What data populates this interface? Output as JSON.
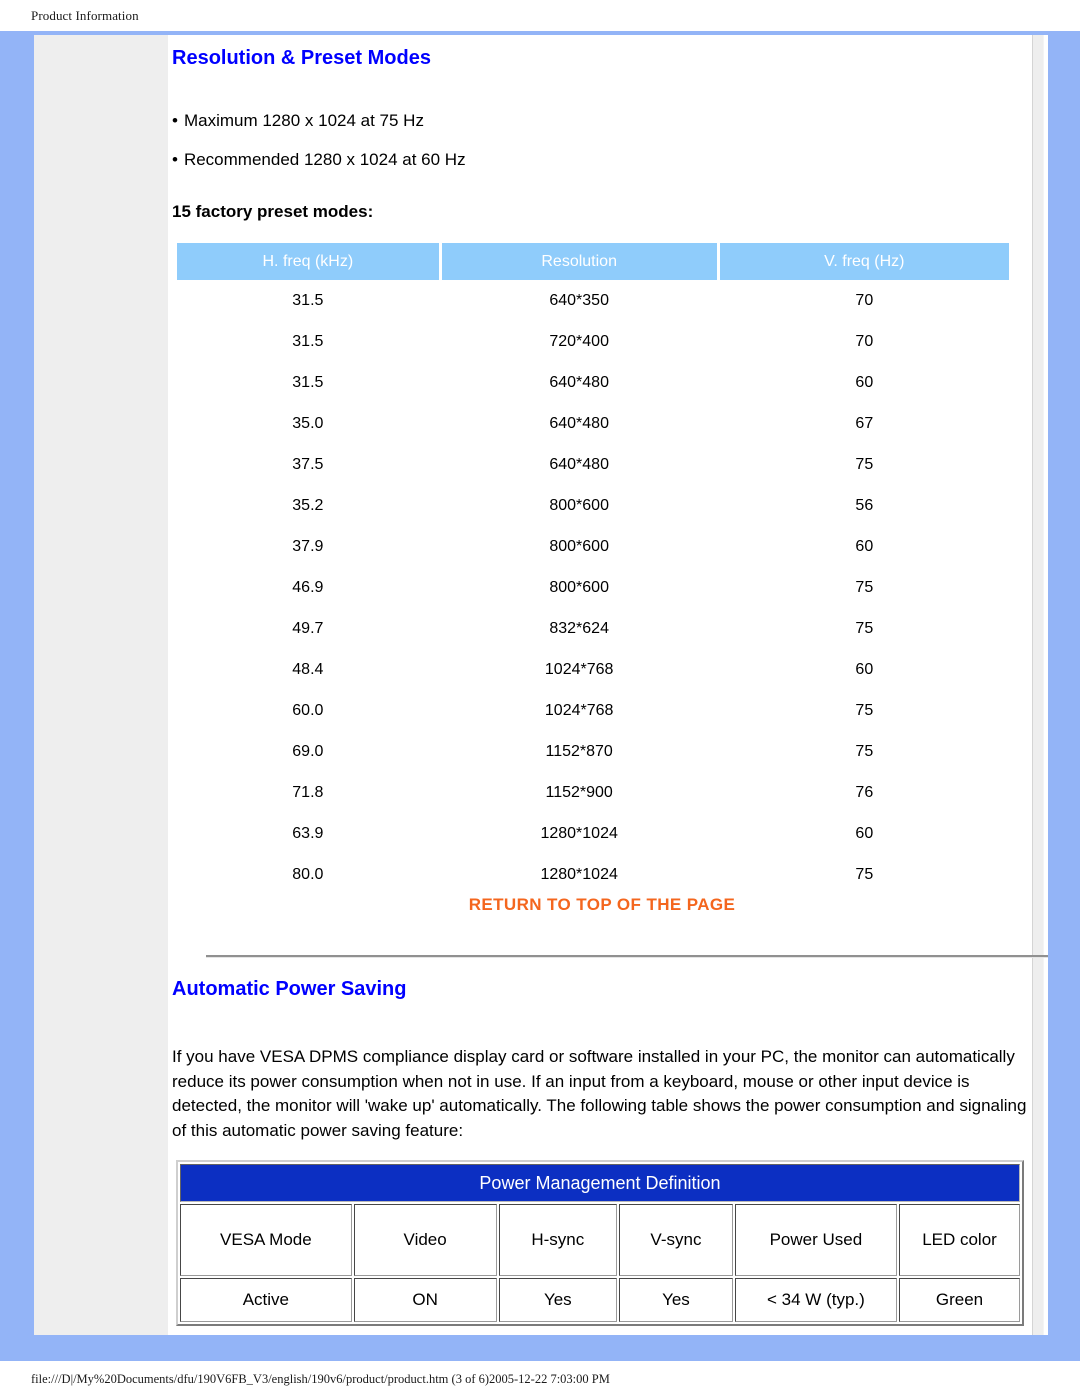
{
  "print": {
    "header_title": "Product Information",
    "footer_path": "file:///D|/My%20Documents/dfu/190V6FB_V3/english/190v6/product/product.htm (3 of 6)2005-12-22 7:03:00 PM"
  },
  "resolution_section": {
    "title": "Resolution & Preset Modes",
    "bullets": [
      "Maximum 1280 x 1024 at 75 Hz",
      "Recommended 1280 x 1024 at 60 Hz"
    ],
    "preset_label": "15 factory preset modes:",
    "table": {
      "headers": [
        "H. freq (kHz)",
        "Resolution",
        "V. freq (Hz)"
      ],
      "rows": [
        [
          "31.5",
          "640*350",
          "70"
        ],
        [
          "31.5",
          "720*400",
          "70"
        ],
        [
          "31.5",
          "640*480",
          "60"
        ],
        [
          "35.0",
          "640*480",
          "67"
        ],
        [
          "37.5",
          "640*480",
          "75"
        ],
        [
          "35.2",
          "800*600",
          "56"
        ],
        [
          "37.9",
          "800*600",
          "60"
        ],
        [
          "46.9",
          "800*600",
          "75"
        ],
        [
          "49.7",
          "832*624",
          "75"
        ],
        [
          "48.4",
          "1024*768",
          "60"
        ],
        [
          "60.0",
          "1024*768",
          "75"
        ],
        [
          "69.0",
          "1152*870",
          "75"
        ],
        [
          "71.8",
          "1152*900",
          "76"
        ],
        [
          "63.9",
          "1280*1024",
          "60"
        ],
        [
          "80.0",
          "1280*1024",
          "75"
        ]
      ]
    },
    "return_link": "RETURN TO TOP OF THE PAGE"
  },
  "power_saving_section": {
    "title": "Automatic Power Saving",
    "paragraph": "If you have VESA DPMS compliance display card or software installed in your PC, the monitor can automatically reduce its power consumption when not in use. If an input from a keyboard, mouse or other input device is detected, the monitor will 'wake up' automatically. The following table shows the power consumption and signaling of this automatic power saving feature:",
    "table": {
      "title": "Power Management Definition",
      "headers": [
        "VESA Mode",
        "Video",
        "H-sync",
        "V-sync",
        "Power Used",
        "LED color"
      ],
      "rows": [
        [
          "Active",
          "ON",
          "Yes",
          "Yes",
          "< 34 W (typ.)",
          "Green"
        ]
      ]
    }
  },
  "colors": {
    "page_border_blue": "#93b4f7",
    "heading_blue": "#0000ff",
    "table_header_blue": "#8fccfb",
    "pmt_title_blue": "#0c2fc2",
    "link_orange": "#f4661e",
    "nav_grey": "#eeeeee"
  }
}
